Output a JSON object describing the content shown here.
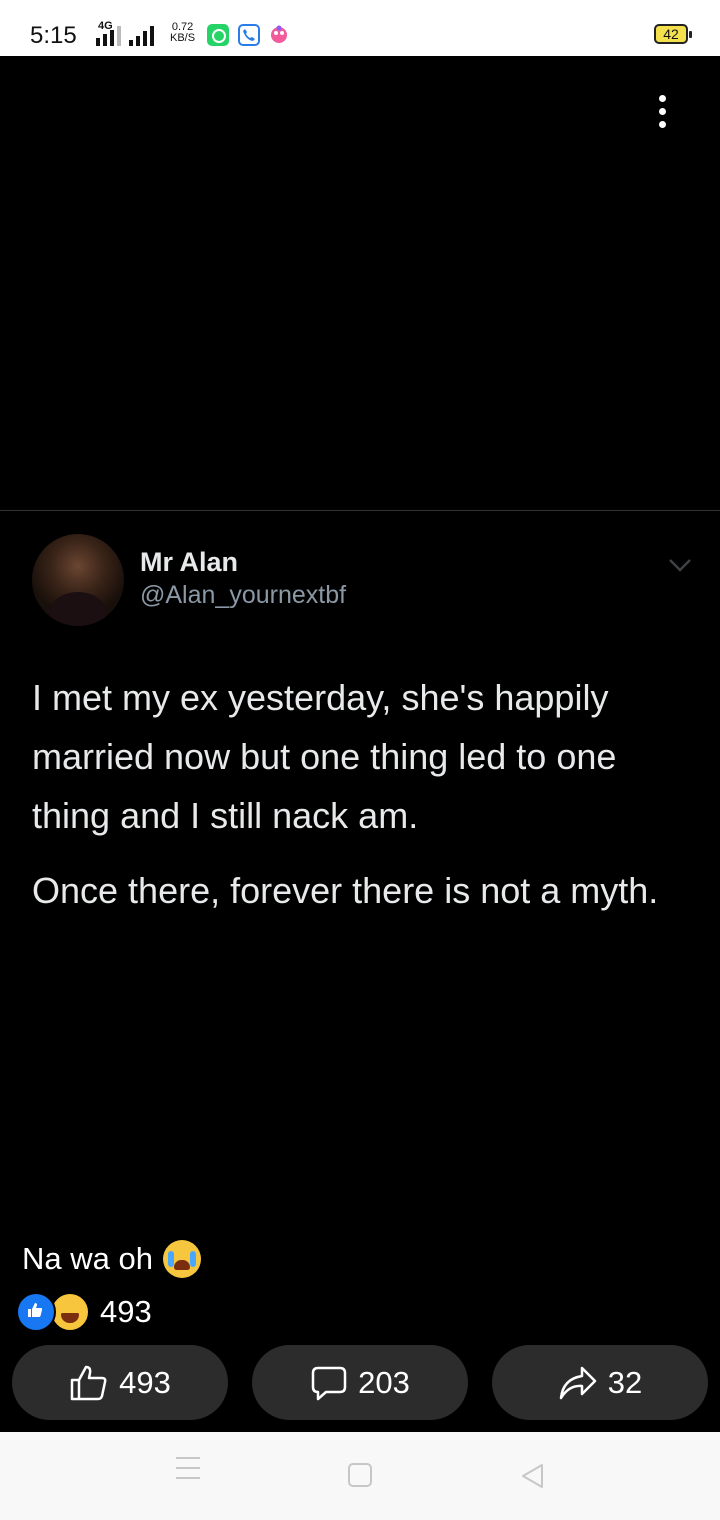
{
  "status_bar": {
    "time": "5:15",
    "network": "4G",
    "speed_value": "0.72",
    "speed_unit": "KB/S",
    "battery": "42",
    "icons": [
      "whatsapp-icon",
      "phone-call-icon",
      "app-icon"
    ]
  },
  "tweet": {
    "display_name": "Mr Alan",
    "handle": "@Alan_yournextbf",
    "paragraphs": [
      "I met my ex yesterday, she's happily married now but one thing led to one thing and I still nack am.",
      "Once there, forever there is not a myth."
    ]
  },
  "post": {
    "caption": "Na wa oh",
    "caption_emoji": "loudly-crying-face-icon",
    "reaction_count": "493",
    "reaction_icons": [
      "like-reaction-icon",
      "haha-reaction-icon"
    ]
  },
  "actions": {
    "like_count": "493",
    "comment_count": "203",
    "share_count": "32"
  },
  "colors": {
    "background": "#000000",
    "button_bg": "#2c2c2c",
    "like_blue": "#1877f2",
    "handle_gray": "#8b98a5"
  }
}
